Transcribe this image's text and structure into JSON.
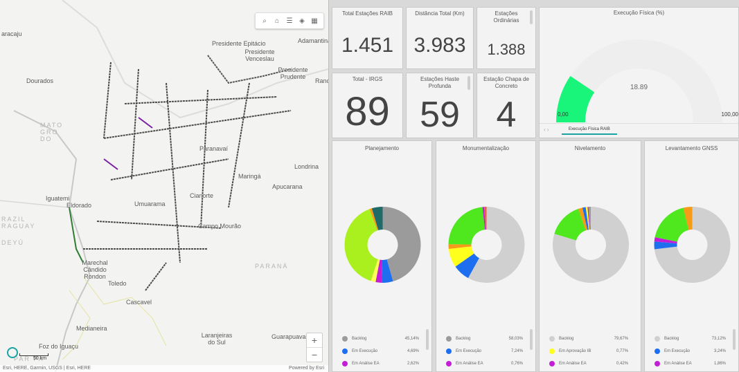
{
  "map": {
    "cities": {
      "aracaju": "aracaju",
      "adamantina": "Adamantina",
      "presidente_epitacio": "Presidente Epitácio",
      "presidente_venceslau": "Presidente Venceslau",
      "presidente_prudente": "Presidente Prudente",
      "dourados": "Dourados",
      "paranavai": "Paranavaí",
      "londrina": "Londrina",
      "maringa": "Maringá",
      "apucarana": "Apucarana",
      "umuarama": "Umuarama",
      "cianorte": "Cianorte",
      "campo_mourao": "Campo Mourão",
      "marechal": "Marechal Cândido Rondon",
      "toledo": "Toledo",
      "cascavel": "Cascavel",
      "medianeira": "Medianeira",
      "foz": "Foz do Iguaçu",
      "laranjeiras": "Laranjeiras do Sul",
      "guarapuava": "Guarapuava",
      "iguatemi": "Iguatemi",
      "eldorado": "Eldorado",
      "ranc": "Ranc"
    },
    "regions": {
      "mato": "MATO GRO DO",
      "parana": "PARANÁ",
      "brazil": "RAZIL",
      "paraguay": "RAGUAY",
      "deyu": "DEYÚ",
      "parana_river": "PAR PA"
    },
    "scale": "50 km",
    "attribution": "Esri, HERE, Garmin, USGS | Esri, HERE",
    "powered": "Powered by Esri",
    "zoom_in": "+",
    "zoom_out": "−",
    "tools": {
      "search": "search-icon",
      "home": "home-icon",
      "list": "list-icon",
      "layers": "layers-icon",
      "grid": "grid-icon"
    }
  },
  "kpis": [
    {
      "label": "Total Estações RAIB",
      "value": "1.451"
    },
    {
      "label": "Distância Total (Km)",
      "value": "3.983"
    },
    {
      "label": "Estações Ordinárias",
      "value": "1.388"
    },
    {
      "label": "Total - IRGS",
      "value": "89"
    },
    {
      "label": "Estações Haste Profunda",
      "value": "59"
    },
    {
      "label": "Estação Chapa de Concreto",
      "value": "4"
    }
  ],
  "gauge": {
    "title": "Execução Física (%)",
    "value": 18.89,
    "value_text": "18.89",
    "min_text": "0,00",
    "max_text": "100,00",
    "color": "#19f57a",
    "track": "#eeeeee",
    "tab": "Execução Física RAIB"
  },
  "donuts": [
    {
      "title": "Planejamento",
      "segments": [
        {
          "label": "Backlog",
          "pct": 45.14,
          "color": "#9b9b9b"
        },
        {
          "label": "Em Execução",
          "pct": 4.69,
          "color": "#1e6ff0"
        },
        {
          "label": "Em Análise EA",
          "pct": 2.62,
          "color": "#c21ed6"
        },
        {
          "label": "",
          "pct": 2.0,
          "color": "#ffff55"
        },
        {
          "label": "",
          "pct": 39.0,
          "color": "#aaf01e"
        },
        {
          "label": "",
          "pct": 1.0,
          "color": "#f59b18"
        },
        {
          "label": "",
          "pct": 4.55,
          "color": "#1e6b68"
        }
      ],
      "legend": [
        {
          "label": "Backlog",
          "pct": "45,14%",
          "color": "#9b9b9b"
        },
        {
          "label": "Em Execução",
          "pct": "4,69%",
          "color": "#1e6ff0"
        },
        {
          "label": "Em Análise EA",
          "pct": "2,62%",
          "color": "#c21ed6"
        }
      ]
    },
    {
      "title": "Monumentalização",
      "segments": [
        {
          "label": "Backlog",
          "pct": 58.03,
          "color": "#d0d0d0"
        },
        {
          "label": "Em Execução",
          "pct": 7.24,
          "color": "#1e6ff0"
        },
        {
          "label": "",
          "pct": 8.0,
          "color": "#ffff1e"
        },
        {
          "label": "",
          "pct": 2.0,
          "color": "#f59b18"
        },
        {
          "label": "",
          "pct": 23.0,
          "color": "#4fe71e"
        },
        {
          "label": "Em Análise EA",
          "pct": 0.76,
          "color": "#c21ed6"
        },
        {
          "label": "",
          "pct": 0.97,
          "color": "#e8604c"
        }
      ],
      "legend": [
        {
          "label": "Backlog",
          "pct": "58,03%",
          "color": "#9b9b9b"
        },
        {
          "label": "Em Execução",
          "pct": "7,24%",
          "color": "#1e6ff0"
        },
        {
          "label": "Em Análise EA",
          "pct": "0,76%",
          "color": "#c21ed6"
        }
      ]
    },
    {
      "title": "Nivelamento",
      "segments": [
        {
          "label": "Backlog",
          "pct": 79.67,
          "color": "#d0d0d0"
        },
        {
          "label": "",
          "pct": 15.0,
          "color": "#4fe71e"
        },
        {
          "label": "",
          "pct": 1.8,
          "color": "#f59b18"
        },
        {
          "label": "",
          "pct": 1.4,
          "color": "#1e6ff0"
        },
        {
          "label": "Em Aprovação IB",
          "pct": 0.77,
          "color": "#ffff1e"
        },
        {
          "label": "Em Análise EA",
          "pct": 0.42,
          "color": "#c21ed6"
        },
        {
          "label": "",
          "pct": 0.94,
          "color": "#9b9b9b"
        }
      ],
      "legend": [
        {
          "label": "Backlog",
          "pct": "79,67%",
          "color": "#d0d0d0"
        },
        {
          "label": "Em Aprovação IB",
          "pct": "0,77%",
          "color": "#ffff1e"
        },
        {
          "label": "Em Análise EA",
          "pct": "0,42%",
          "color": "#c21ed6"
        }
      ]
    },
    {
      "title": "Levantamento GNSS",
      "segments": [
        {
          "label": "Backlog",
          "pct": 73.12,
          "color": "#d0d0d0"
        },
        {
          "label": "Em Execução",
          "pct": 3.24,
          "color": "#1e6ff0"
        },
        {
          "label": "Em Análise EA",
          "pct": 1.86,
          "color": "#c21ed6"
        },
        {
          "label": "",
          "pct": 18.0,
          "color": "#4fe71e"
        },
        {
          "label": "",
          "pct": 3.78,
          "color": "#f59b18"
        }
      ],
      "legend": [
        {
          "label": "Backlog",
          "pct": "73,12%",
          "color": "#d0d0d0"
        },
        {
          "label": "Em Execução",
          "pct": "3,24%",
          "color": "#1e6ff0"
        },
        {
          "label": "Em Análise EA",
          "pct": "1,86%",
          "color": "#c21ed6"
        }
      ]
    }
  ]
}
